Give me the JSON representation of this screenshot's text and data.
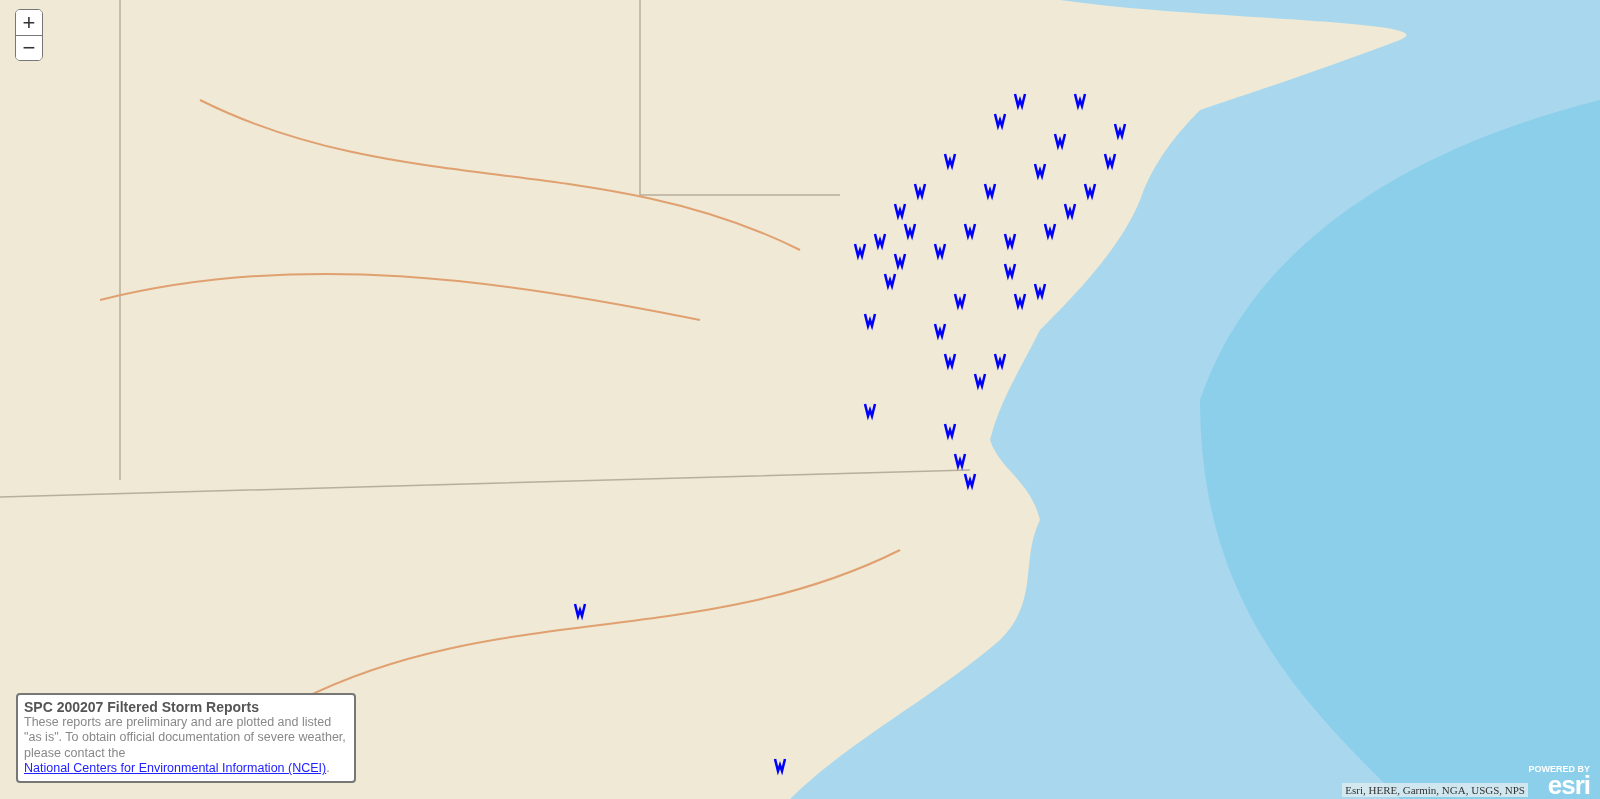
{
  "zoom_controls": [
    {
      "kind": "zoom_in",
      "label": "+"
    },
    {
      "kind": "zoom_out",
      "label": "−"
    }
  ],
  "legend": {
    "title": "SPC 200207 Filtered Storm Reports",
    "text": "These reports are preliminary and are plotted and listed \"as is\". To obtain official documentation of severe weather, please contact the",
    "link": "National Centers for Environmental Information (NCEI)",
    "after_link": "."
  },
  "attribution": "Esri, HERE, Garmin, NGA, USGS, NPS",
  "logo": {
    "tagline": "POWERED BY",
    "name": "esri"
  }
}
